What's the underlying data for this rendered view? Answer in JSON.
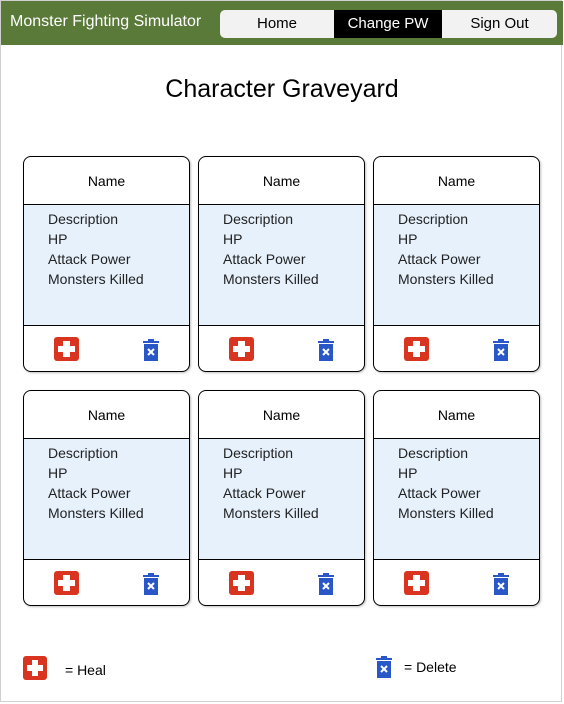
{
  "header": {
    "app_title": "Monster Fighting Simulator",
    "nav": {
      "home": "Home",
      "change_pw": "Change PW",
      "sign_out": "Sign Out"
    }
  },
  "page": {
    "title": "Character Graveyard"
  },
  "cards": [
    {
      "name": "Name",
      "description": "Description",
      "hp": "HP",
      "attack": "Attack Power",
      "killed": "Monsters Killed"
    },
    {
      "name": "Name",
      "description": "Description",
      "hp": "HP",
      "attack": "Attack Power",
      "killed": "Monsters Killed"
    },
    {
      "name": "Name",
      "description": "Description",
      "hp": "HP",
      "attack": "Attack Power",
      "killed": "Monsters Killed"
    },
    {
      "name": "Name",
      "description": "Description",
      "hp": "HP",
      "attack": "Attack Power",
      "killed": "Monsters Killed"
    },
    {
      "name": "Name",
      "description": "Description",
      "hp": "HP",
      "attack": "Attack Power",
      "killed": "Monsters Killed"
    },
    {
      "name": "Name",
      "description": "Description",
      "hp": "HP",
      "attack": "Attack Power",
      "killed": "Monsters Killed"
    }
  ],
  "legend": {
    "heal": "= Heal",
    "delete": "= Delete"
  },
  "icons": {
    "heal": "red-cross-heal-icon",
    "delete": "trash-delete-icon"
  },
  "colors": {
    "header_bg": "#5a7a3a",
    "card_body_bg": "#e6f1fc",
    "heal_red": "#d9341f",
    "delete_blue": "#2a57c8"
  }
}
